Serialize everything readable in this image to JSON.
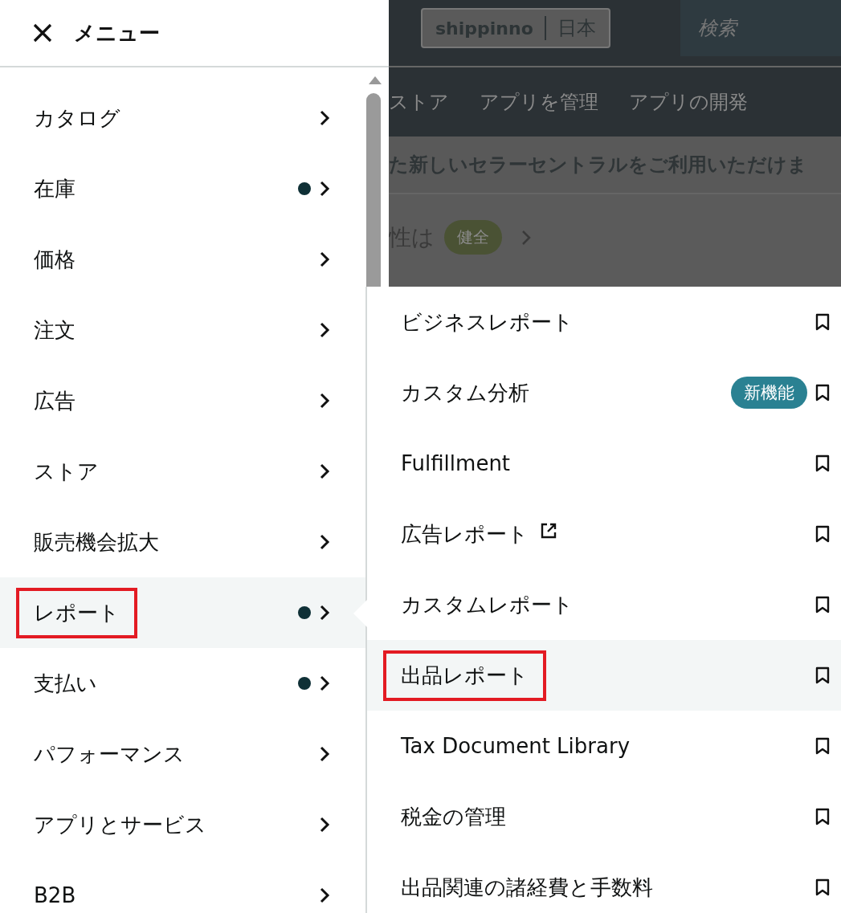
{
  "background": {
    "store_chip": {
      "store": "shippinno",
      "region": "日本"
    },
    "search": {
      "placeholder": "検索"
    },
    "nav": [
      "ストア",
      "アプリを管理",
      "アプリの開発"
    ],
    "banner": "た新しいセラーセントラルをご利用いただけま",
    "status": {
      "label": "性は",
      "badge": "健全"
    }
  },
  "menu": {
    "title": "メニュー",
    "items": [
      {
        "label": "カタログ",
        "dot": false,
        "selected": false,
        "annotated": false
      },
      {
        "label": "在庫",
        "dot": true,
        "selected": false,
        "annotated": false
      },
      {
        "label": "価格",
        "dot": false,
        "selected": false,
        "annotated": false
      },
      {
        "label": "注文",
        "dot": false,
        "selected": false,
        "annotated": false
      },
      {
        "label": "広告",
        "dot": false,
        "selected": false,
        "annotated": false
      },
      {
        "label": "ストア",
        "dot": false,
        "selected": false,
        "annotated": false
      },
      {
        "label": "販売機会拡大",
        "dot": false,
        "selected": false,
        "annotated": false
      },
      {
        "label": "レポート",
        "dot": true,
        "selected": true,
        "annotated": true
      },
      {
        "label": "支払い",
        "dot": true,
        "selected": false,
        "annotated": false
      },
      {
        "label": "パフォーマンス",
        "dot": false,
        "selected": false,
        "annotated": false
      },
      {
        "label": "アプリとサービス",
        "dot": false,
        "selected": false,
        "annotated": false
      },
      {
        "label": "B2B",
        "dot": false,
        "selected": false,
        "annotated": false
      }
    ]
  },
  "submenu": {
    "items": [
      {
        "label": "ビジネスレポート",
        "external": false,
        "selected": false,
        "annotated": false
      },
      {
        "label": "カスタム分析",
        "badge": "新機能",
        "external": false,
        "selected": false,
        "annotated": false
      },
      {
        "label": "Fulfillment",
        "external": false,
        "selected": false,
        "annotated": false
      },
      {
        "label": "広告レポート",
        "external": true,
        "selected": false,
        "annotated": false
      },
      {
        "label": "カスタムレポート",
        "external": false,
        "selected": false,
        "annotated": false
      },
      {
        "label": "出品レポート",
        "external": false,
        "selected": true,
        "annotated": true
      },
      {
        "label": "Tax Document Library",
        "external": false,
        "selected": false,
        "annotated": false
      },
      {
        "label": "税金の管理",
        "external": false,
        "selected": false,
        "annotated": false
      },
      {
        "label": "出品関連の諸経費と手数料",
        "external": false,
        "selected": false,
        "annotated": false
      }
    ]
  }
}
